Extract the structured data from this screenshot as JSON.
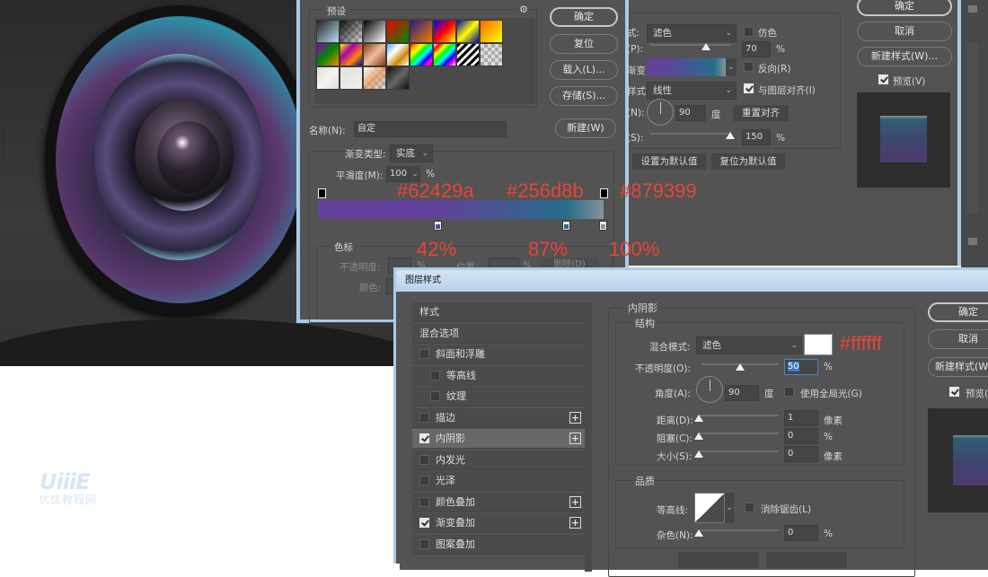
{
  "watermark": {
    "logo": "UiiiE",
    "text": "优优教程网"
  },
  "gradient_editor": {
    "presets_label": "预设",
    "buttons": {
      "ok": "确定",
      "reset": "复位",
      "load": "载入(L)...",
      "save": "存储(S)...",
      "new": "新建(W)"
    },
    "name_label": "名称(N):",
    "name_value": "自定",
    "type_label": "渐变类型:",
    "type_value": "实底",
    "smoothness_label": "平滑度(M):",
    "smoothness_value": "100",
    "smoothness_unit": "%",
    "stops_group_label": "色标",
    "opacity_label": "不透明度:",
    "opacity_unit": "%",
    "location_label": "位置:",
    "location_unit": "%",
    "delete_label": "删除(D)",
    "color_label": "颜色:",
    "color_stops": [
      {
        "color": "#62429a",
        "position": 42
      },
      {
        "color": "#256d8b",
        "position": 87
      },
      {
        "color": "#879399",
        "position": 100
      }
    ],
    "annotations": {
      "c1": "#62429a",
      "c2": "#256d8b",
      "c3": "#879399",
      "p1": "42%",
      "p2": "87%",
      "p3": "100%"
    }
  },
  "gradient_overlay": {
    "blend_label": "式:",
    "blend_value": "滤色",
    "dither_label": "仿色",
    "opacity_label": "(P):",
    "opacity_value": "70",
    "opacity_unit": "%",
    "gradient_label": "渐变:",
    "reverse_label": "反向(R)",
    "style_label": "样式:",
    "style_value": "线性",
    "align_label": "与图层对齐(I)",
    "angle_label": "(N):",
    "angle_value": "90",
    "angle_unit": "度",
    "reset_align_label": "重置对齐",
    "scale_label": "(S):",
    "scale_value": "150",
    "scale_unit": "%",
    "set_default": "设置为默认值",
    "reset_default": "复位为默认值"
  },
  "right_panel_top": {
    "ok": "确定",
    "cancel": "取消",
    "new_style": "新建样式(W)...",
    "preview": "预览(V)"
  },
  "layer_style": {
    "title": "图层样式",
    "styles": [
      {
        "label": "样式",
        "checkbox": false,
        "has_check": false,
        "plus": false
      },
      {
        "label": "混合选项",
        "checkbox": false,
        "has_check": false,
        "plus": false
      },
      {
        "label": "斜面和浮雕",
        "checkbox": false,
        "has_check": true,
        "plus": false
      },
      {
        "label": "等高线",
        "checkbox": false,
        "has_check": true,
        "plus": false,
        "indent": true
      },
      {
        "label": "纹理",
        "checkbox": false,
        "has_check": true,
        "plus": false,
        "indent": true
      },
      {
        "label": "描边",
        "checkbox": false,
        "has_check": true,
        "plus": true
      },
      {
        "label": "内阴影",
        "checkbox": true,
        "has_check": true,
        "plus": true,
        "active": true
      },
      {
        "label": "内发光",
        "checkbox": false,
        "has_check": true,
        "plus": false
      },
      {
        "label": "光泽",
        "checkbox": false,
        "has_check": true,
        "plus": false
      },
      {
        "label": "颜色叠加",
        "checkbox": false,
        "has_check": true,
        "plus": true
      },
      {
        "label": "渐变叠加",
        "checkbox": true,
        "has_check": true,
        "plus": true
      },
      {
        "label": "图案叠加",
        "checkbox": false,
        "has_check": true,
        "plus": false
      }
    ],
    "inner_shadow": {
      "section_title": "内阴影",
      "structure_label": "结构",
      "blend_label": "混合模式:",
      "blend_value": "滤色",
      "color": "#ffffff",
      "color_annotation": "#ffffff",
      "opacity_label": "不透明度(O):",
      "opacity_value": "50",
      "opacity_unit": "%",
      "opacity_percent": 50,
      "angle_label": "角度(A):",
      "angle_value": "90",
      "angle_unit": "度",
      "global_light_label": "使用全局光(G)",
      "distance_label": "距离(D):",
      "distance_value": "1",
      "distance_unit": "像素",
      "choke_label": "阻塞(C):",
      "choke_value": "0",
      "choke_unit": "%",
      "size_label": "大小(S):",
      "size_value": "0",
      "size_unit": "像素",
      "quality_label": "品质",
      "contour_label": "等高线:",
      "antialias_label": "消除锯齿(L)",
      "noise_label": "杂色(N):",
      "noise_value": "0",
      "noise_unit": "%"
    },
    "buttons": {
      "ok": "确定",
      "cancel": "取消",
      "new_style": "新建样式(W)...",
      "preview": "预览(V)"
    }
  }
}
